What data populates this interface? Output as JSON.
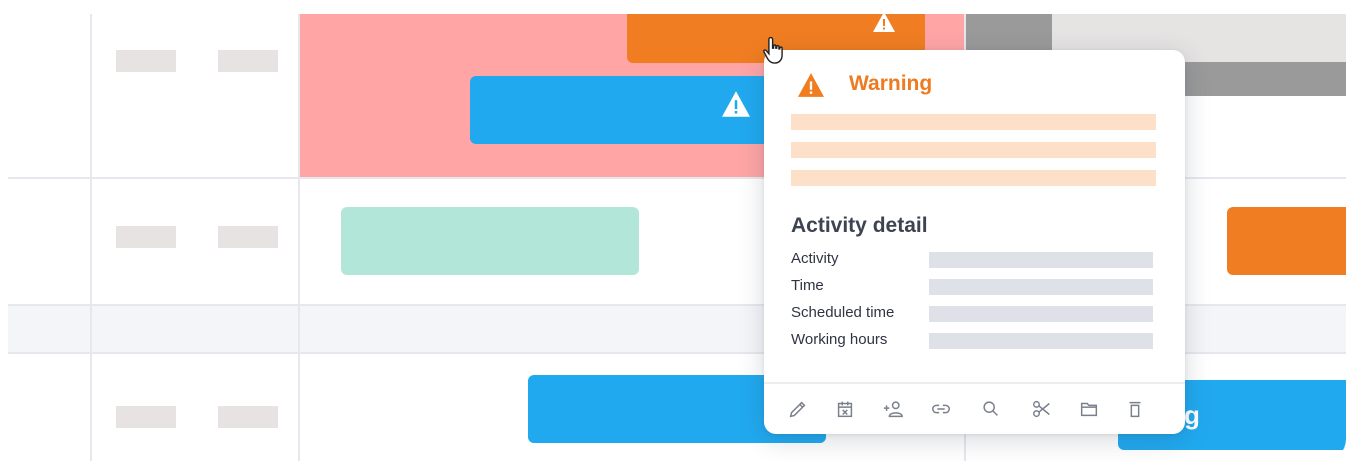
{
  "gantt": {
    "colors": {
      "conflict_region": "#ffa5a6",
      "orange_bar": "#f07d21",
      "blue_bar": "#21a9ef",
      "mint_bar": "#b1e6d9",
      "gray_bar": "#9a9a9a",
      "light_gray_region": "#e6e3e3",
      "placeholder": "#e7e3e3"
    },
    "partial_bar_text": "g"
  },
  "tooltip": {
    "warning_title": "Warning",
    "detail_title": "Activity detail",
    "rows": [
      {
        "label": "Activity"
      },
      {
        "label": "Time"
      },
      {
        "label": "Scheduled time"
      },
      {
        "label": "Working hours"
      }
    ],
    "toolbar": [
      {
        "icon": "pencil-icon"
      },
      {
        "icon": "calendar-x-icon"
      },
      {
        "icon": "add-person-icon"
      },
      {
        "icon": "link-icon"
      },
      {
        "icon": "search-icon"
      },
      {
        "icon": "scissors-icon"
      },
      {
        "icon": "folder-icon"
      },
      {
        "icon": "trash-icon"
      }
    ]
  }
}
